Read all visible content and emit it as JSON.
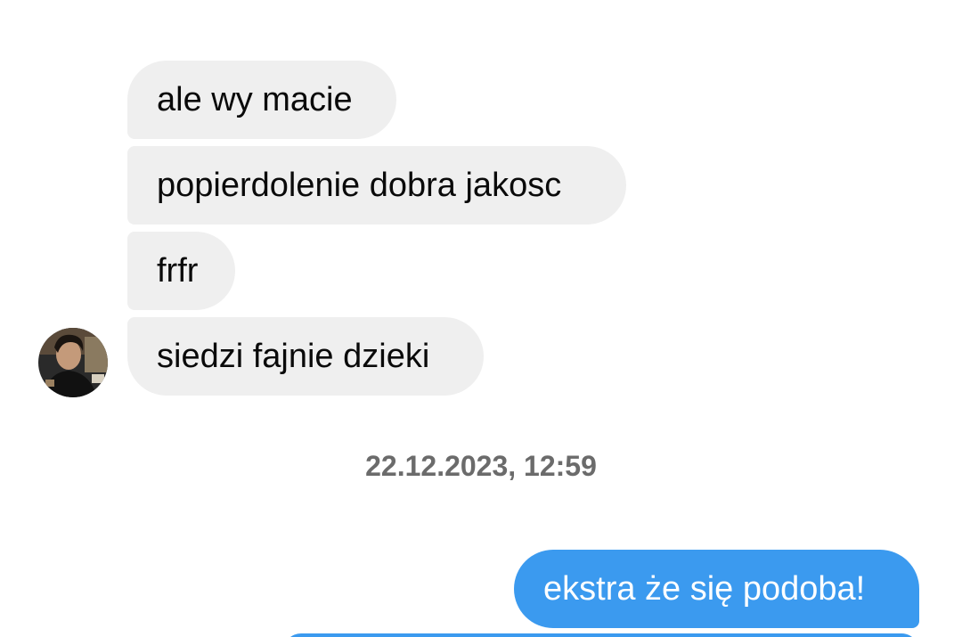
{
  "conversation": {
    "incoming": [
      {
        "text": "ale wy macie"
      },
      {
        "text": "popierdolenie dobra jakosc"
      },
      {
        "text": "frfr"
      },
      {
        "text": "siedzi fajnie dzieki"
      }
    ],
    "timestamp": "22.12.2023, 12:59",
    "outgoing": [
      {
        "text": "ekstra że się podoba!"
      }
    ]
  },
  "contact": {
    "avatar_icon": "profile-photo-icon"
  },
  "colors": {
    "incoming_bubble": "#efefef",
    "outgoing_bubble": "#3b9aef",
    "timestamp_text": "#6b6b6b"
  }
}
